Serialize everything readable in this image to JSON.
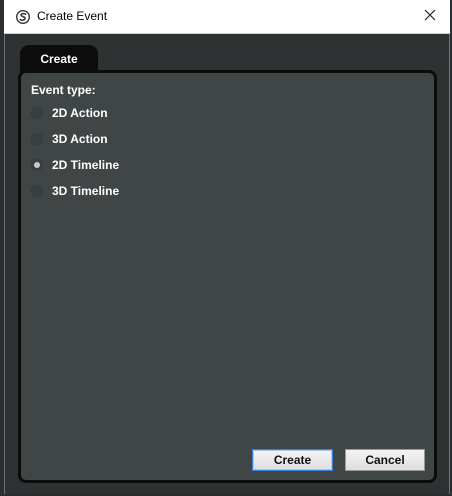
{
  "window": {
    "title": "Create Event"
  },
  "tabs": [
    {
      "label": "Create",
      "active": true
    }
  ],
  "form": {
    "event_type_label": "Event type:",
    "options": [
      {
        "label": "2D Action",
        "checked": false
      },
      {
        "label": "3D Action",
        "checked": false
      },
      {
        "label": "2D Timeline",
        "checked": true
      },
      {
        "label": "3D Timeline",
        "checked": false
      }
    ]
  },
  "buttons": {
    "create_label": "Create",
    "cancel_label": "Cancel"
  },
  "colors": {
    "panel_bg": "#404546",
    "tab_bg": "#0c0c0c",
    "focus_border": "#3c7fd6"
  }
}
